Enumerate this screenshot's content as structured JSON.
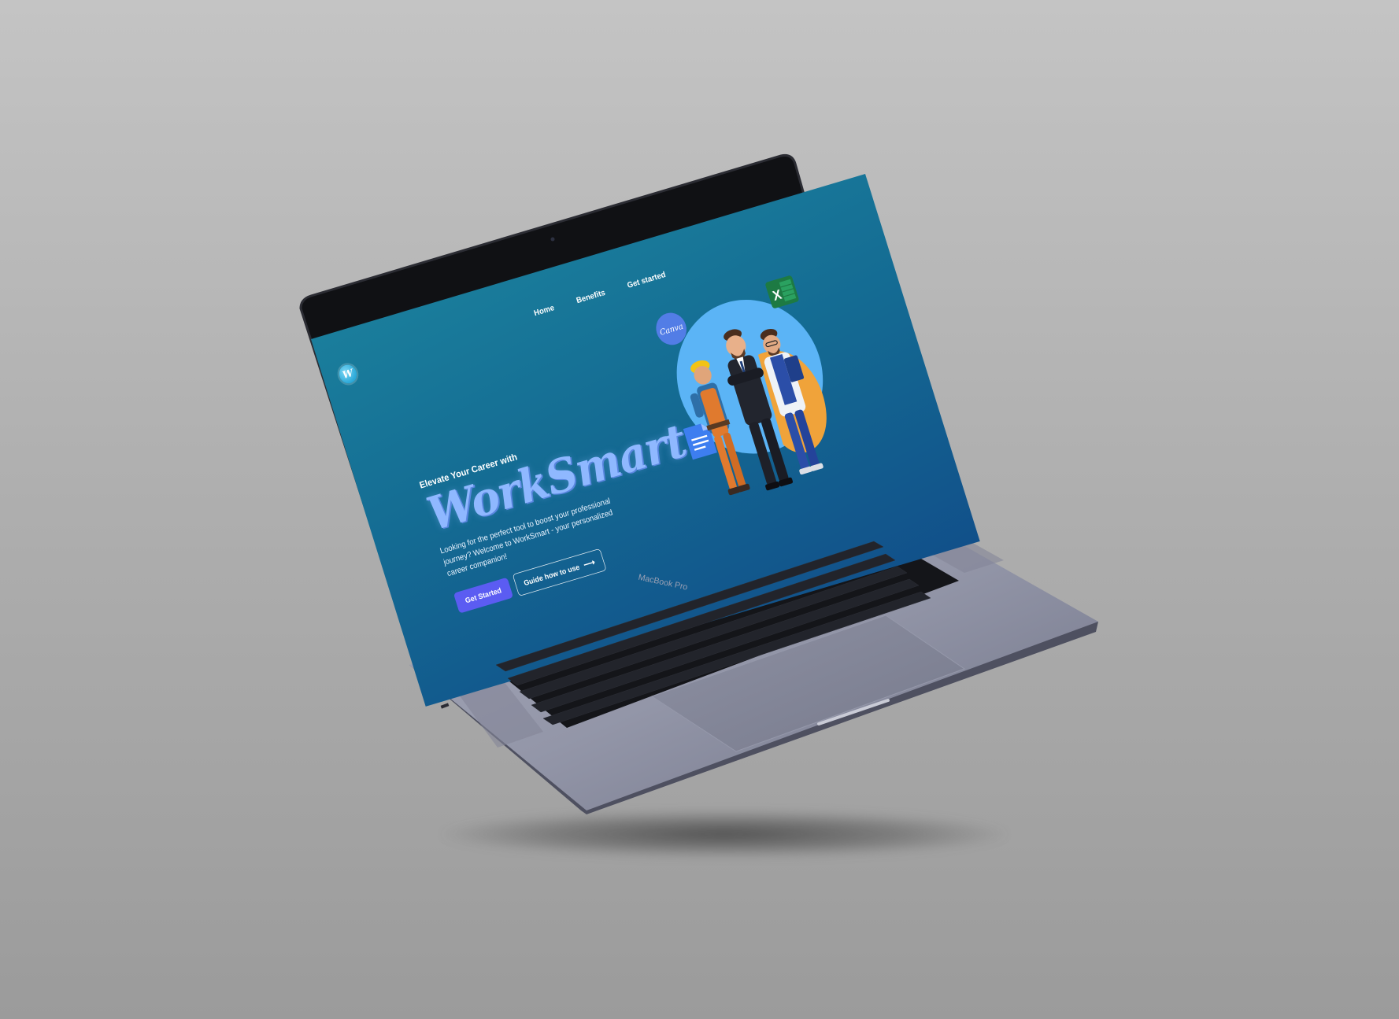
{
  "nav": {
    "items": [
      "Home",
      "Benefits",
      "Get started"
    ]
  },
  "logo": {
    "letter": "W"
  },
  "hero": {
    "kicker": "Elevate Your Career with",
    "brand": "WorkSmart",
    "description": "Looking for the perfect tool to boost your professional journey? Welcome to WorkSmart - your personalized career companion!",
    "primary_button": "Get Started",
    "secondary_button": "Guide how to use"
  },
  "illustration": {
    "canva_label": "Canva",
    "excel_label": "X"
  },
  "device": {
    "label": "MacBook Pro"
  },
  "colors": {
    "screen_top": "#1a7e9c",
    "screen_bottom": "#11508a",
    "brand_text": "#8fb8ff",
    "primary_button": "#5b5cf2",
    "blob_blue": "#5bb4f6",
    "blob_orange": "#f0a33a"
  }
}
